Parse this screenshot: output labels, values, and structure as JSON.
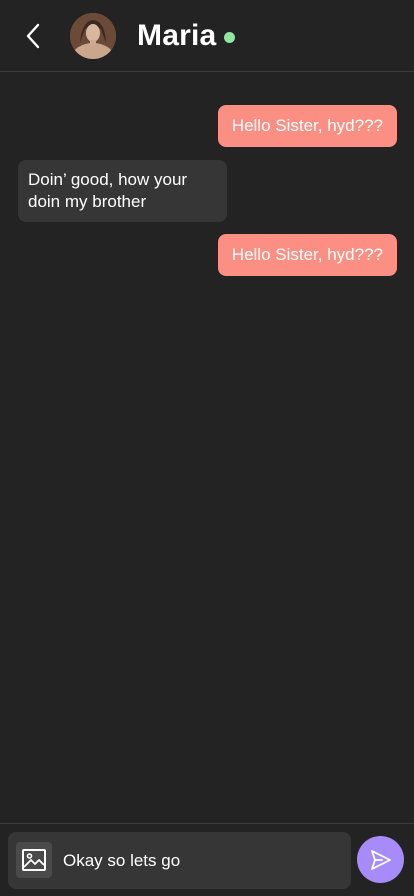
{
  "header": {
    "contact_name": "Maria",
    "status": "online",
    "status_color": "#8ee6a0"
  },
  "icons": {
    "back": "chevron-left-icon",
    "avatar": "avatar",
    "image": "image-icon",
    "send": "send-icon"
  },
  "messages": [
    {
      "direction": "sent",
      "text": "Hello Sister, hyd???"
    },
    {
      "direction": "received",
      "text": "Doin’ good, how your doin my brother"
    },
    {
      "direction": "sent",
      "text": "Hello Sister, hyd???"
    }
  ],
  "composer": {
    "value": "Okay so lets go"
  },
  "colors": {
    "background": "#232323",
    "sent_bubble": "#fb8f84",
    "received_bubble": "#363636",
    "send_button": "#a78bfa"
  }
}
